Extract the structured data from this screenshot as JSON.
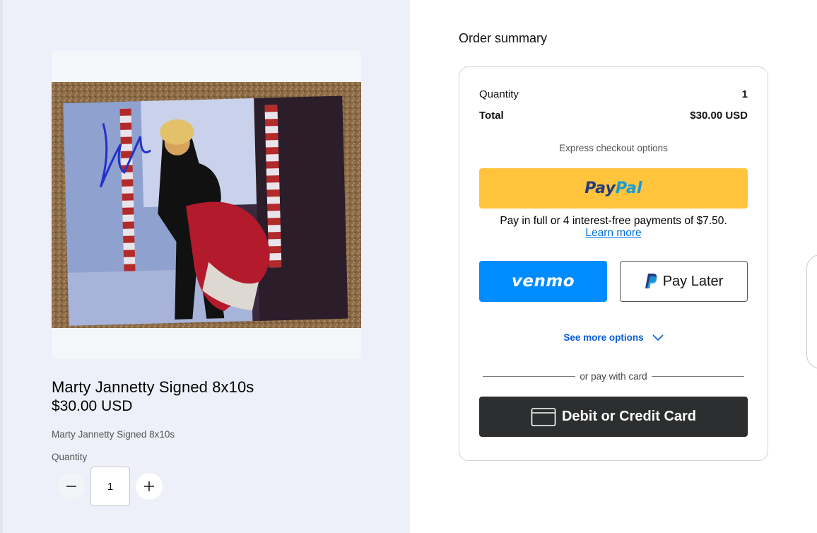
{
  "product": {
    "title": "Marty Jannetty Signed 8x10s",
    "price": "$30.00 USD",
    "description": "Marty Jannetty Signed 8x10s",
    "quantity_label": "Quantity",
    "quantity_value": "1"
  },
  "summary": {
    "heading": "Order summary",
    "quantity_label": "Quantity",
    "quantity_value": "1",
    "total_label": "Total",
    "total_value": "$30.00 USD",
    "express_label": "Express checkout options",
    "paypal_pay": "Pay",
    "paypal_pal": "Pal",
    "paylater_message": "Pay in full or 4 interest-free payments of $7.50.",
    "learn_more": "Learn more",
    "venmo_label": "venmo",
    "pay_later_label": "Pay Later",
    "see_more_label": "See more options",
    "divider_text": "or pay with card",
    "card_button_label": "Debit or Credit Card"
  },
  "icons": {
    "minus": "minus-icon",
    "plus": "plus-icon",
    "chevron": "chevron-down-icon",
    "card": "credit-card-icon",
    "paypal_mark": "paypal-p-icon"
  },
  "colors": {
    "paypal_yellow": "#ffc43b",
    "venmo_blue": "#008cff",
    "card_dark": "#2c2e2f",
    "link_blue": "#0070e0",
    "left_bg": "#edf0f8"
  }
}
